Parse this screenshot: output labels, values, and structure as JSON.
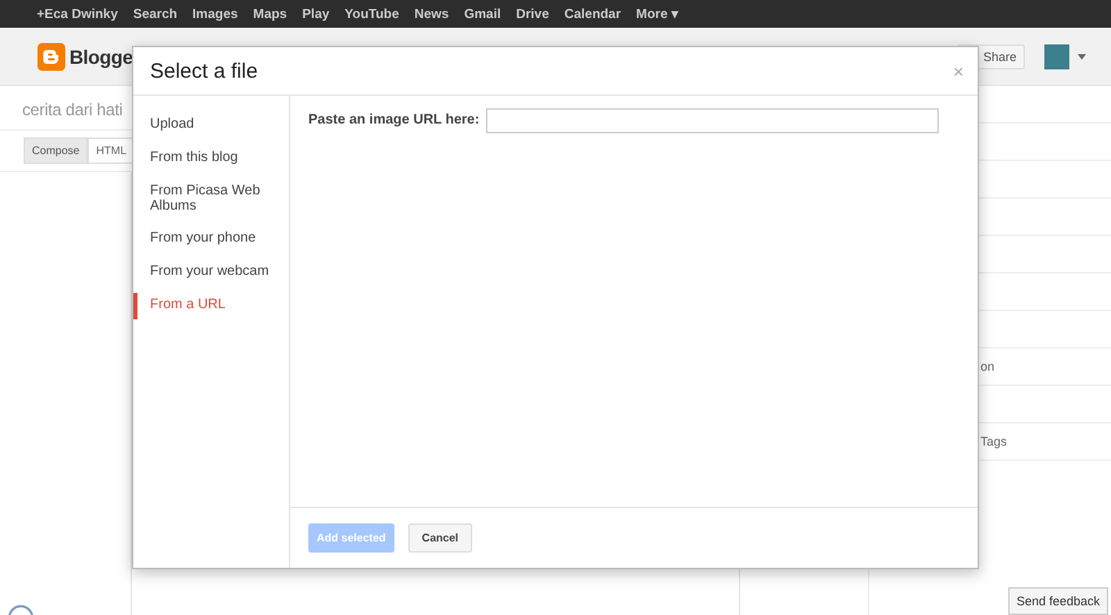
{
  "topbar": {
    "items": [
      {
        "label": "+Eca Dwinky",
        "selected": false
      },
      {
        "label": "Search",
        "selected": false
      },
      {
        "label": "Images",
        "selected": false
      },
      {
        "label": "Maps",
        "selected": false
      },
      {
        "label": "Play",
        "selected": false
      },
      {
        "label": "YouTube",
        "selected": false
      },
      {
        "label": "News",
        "selected": false
      },
      {
        "label": "Gmail",
        "selected": false
      },
      {
        "label": "Drive",
        "selected": false
      },
      {
        "label": "Calendar",
        "selected": false
      },
      {
        "label": "More ▾",
        "selected": false
      }
    ]
  },
  "header": {
    "logo_text": "Blogge",
    "share": "Share"
  },
  "post": {
    "blog_title": "cerita dari hati",
    "modes": [
      {
        "label": "Compose",
        "selected": true
      },
      {
        "label": "HTML",
        "selected": false
      }
    ]
  },
  "settings_sidebar": {
    "items": [
      "on",
      "Tags"
    ]
  },
  "dialog": {
    "title": "Select a file",
    "close": "×",
    "sources": [
      {
        "label": "Upload",
        "selected": false
      },
      {
        "label": "From this blog",
        "selected": false
      },
      {
        "label": "From Picasa Web Albums",
        "selected": false
      },
      {
        "label": "From your phone",
        "selected": false
      },
      {
        "label": "From your webcam",
        "selected": false
      },
      {
        "label": "From a URL",
        "selected": true
      }
    ],
    "url_label": "Paste an image URL here:",
    "add_button": {
      "label": "Add selected",
      "disabled": true
    },
    "cancel_button": "Cancel"
  },
  "feedback_button": "Send feedback"
}
